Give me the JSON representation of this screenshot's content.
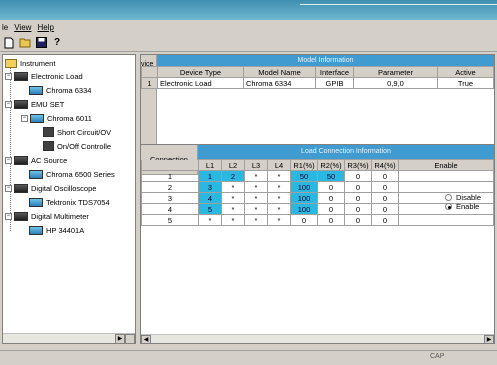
{
  "menu": [
    "le",
    "View",
    "Help"
  ],
  "toolbar": {
    "icons": [
      "new-file-icon",
      "open-folder-icon",
      "save-icon",
      "help-icon"
    ]
  },
  "tree": {
    "root": "Instrument",
    "nodes": [
      {
        "label": "Electronic Load"
      },
      {
        "label": "Chroma 6334"
      },
      {
        "label": "EMU SET"
      },
      {
        "label": "Chroma 6011"
      },
      {
        "label": "Short Circuit/OV"
      },
      {
        "label": "On/Off Controlle"
      },
      {
        "label": "AC Source"
      },
      {
        "label": "Chroma 6500 Series"
      },
      {
        "label": "Digital Oscilloscope"
      },
      {
        "label": "Tektronix TDS7054"
      },
      {
        "label": "Digital Multimeter"
      },
      {
        "label": "HP 34401A"
      }
    ]
  },
  "model_info": {
    "title": "Model Information",
    "side_label": "vice I",
    "headers": [
      "",
      "Device Type",
      "Model Name",
      "Interface",
      "Parameter",
      "Active"
    ],
    "rows": [
      [
        "1",
        "Electronic Load",
        "Chroma 6334",
        "GPIB",
        "0,9,0",
        "True"
      ]
    ]
  },
  "load_conn": {
    "title": "Load Connection Information",
    "connection_label": "Connection",
    "headers": [
      "L1",
      "L2",
      "L3",
      "L4",
      "R1(%)",
      "R2(%)",
      "R3(%)",
      "R4(%)",
      "Enable"
    ],
    "rows": [
      {
        "n": "1",
        "cells": [
          "1",
          "2",
          "*",
          "*",
          "50",
          "50",
          "0",
          "0"
        ]
      },
      {
        "n": "2",
        "cells": [
          "3",
          "*",
          "*",
          "*",
          "100",
          "0",
          "0",
          "0"
        ]
      },
      {
        "n": "3",
        "cells": [
          "4",
          "*",
          "*",
          "*",
          "100",
          "0",
          "0",
          "0"
        ]
      },
      {
        "n": "4",
        "cells": [
          "5",
          "*",
          "*",
          "*",
          "100",
          "0",
          "0",
          "0"
        ]
      },
      {
        "n": "5",
        "cells": [
          "*",
          "*",
          "*",
          "*",
          "0",
          "0",
          "0",
          "0"
        ]
      }
    ],
    "enable_options": [
      {
        "label": "Disable",
        "selected": false
      },
      {
        "label": "Enable",
        "selected": true
      }
    ]
  },
  "status": {
    "text": "CAP"
  },
  "colors": {
    "header_blue": "#3f9bd0",
    "cell_cyan": "#2ab8e0"
  }
}
